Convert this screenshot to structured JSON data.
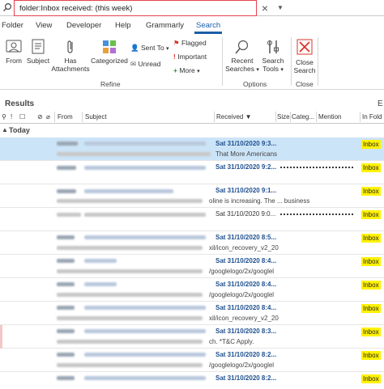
{
  "search": {
    "query": "folder:Inbox received: (this week)",
    "close_glyph": "×",
    "dropdown_glyph": "▼"
  },
  "menu": {
    "tabs": [
      "Folder",
      "View",
      "Developer",
      "Help",
      "Grammarly",
      "Search"
    ],
    "active": "Search"
  },
  "ribbon": {
    "from": "From",
    "subject": "Subject",
    "has_attachments_1": "Has",
    "has_attachments_2": "Attachments",
    "categorized": "Categorized",
    "sent_to": "Sent To",
    "unread": "Unread",
    "flagged": "Flagged",
    "important": "Important",
    "more": "More",
    "refine_label": "Refine",
    "recent_searches_1": "Recent",
    "recent_searches_2": "Searches",
    "search_tools_1": "Search",
    "search_tools_2": "Tools",
    "options_label": "Options",
    "close_search_1": "Close",
    "close_search_2": "Search",
    "close_label": "Close"
  },
  "results": {
    "title": "Results",
    "right_glyph": "E"
  },
  "columns": {
    "from": "From",
    "subject": "Subject",
    "received": "Received",
    "size": "Size",
    "categories": "Categ...",
    "mention": "Mention",
    "in_folder": "In Fold"
  },
  "group": {
    "label": "Today",
    "caret": "▲"
  },
  "rows": [
    {
      "received": "Sat 31/10/2020 9:3...",
      "snippet": "That More Americans",
      "folder": "Inbox",
      "selected": true
    },
    {
      "received": "Sat 31/10/2020 9:2...",
      "snippet": "",
      "folder": "Inbox",
      "selected": false
    },
    {
      "received": "Sat 31/10/2020 9:1...",
      "snippet": "oline is increasing.  The ... business",
      "folder": "Inbox",
      "selected": false
    },
    {
      "received": "Sat 31/10/2020 9:0...",
      "snippet": "",
      "folder": "Inbox",
      "selected": false
    },
    {
      "received": "Sat 31/10/2020 8:5...",
      "snippet": "xil/icon_recovery_v2_20",
      "folder": "Inbox",
      "selected": false
    },
    {
      "received": "Sat 31/10/2020 8:4...",
      "snippet": "/googlelogo/2x/googlel",
      "folder": "Inbox",
      "selected": false
    },
    {
      "received": "Sat 31/10/2020 8:4...",
      "snippet": "/googlelogo/2x/googlel",
      "folder": "Inbox",
      "selected": false
    },
    {
      "received": "Sat 31/10/2020 8:4...",
      "snippet": "xil/icon_recovery_v2_20",
      "folder": "Inbox",
      "selected": false
    },
    {
      "received": "Sat 31/10/2020 8:3...",
      "snippet": "ch. *T&C Apply.",
      "folder": "Inbox",
      "selected": false
    },
    {
      "received": "Sat 31/10/2020 8:2...",
      "snippet": "/googlelogo/2x/googlel",
      "folder": "Inbox",
      "selected": false
    },
    {
      "received": "Sat 31/10/2020 8:2...",
      "snippet": "",
      "folder": "Inbox",
      "selected": false
    }
  ],
  "colors": {
    "accent": "#1a5ea8",
    "highlight_box": "#e8424e",
    "selected_row": "#cce4f7",
    "inbox_highlight": "#fff200"
  }
}
